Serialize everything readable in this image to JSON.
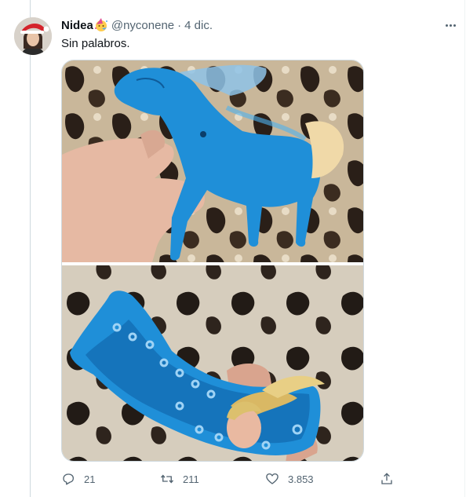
{
  "tweet": {
    "display_name": "Nidea",
    "name_emoji_icon": "party-face-icon",
    "handle": "@nyconene",
    "separator": "·",
    "date": "4 dic.",
    "text": "Sin palabros.",
    "more_icon": "more-options-icon"
  },
  "media": {
    "images": [
      {
        "subject": "blue toy horse held in hand"
      },
      {
        "subject": "hollow blue toy horse with doll head inside"
      }
    ]
  },
  "actions": {
    "reply": {
      "icon": "reply-icon",
      "count": "21"
    },
    "retweet": {
      "icon": "retweet-icon",
      "count": "211"
    },
    "like": {
      "icon": "heart-icon",
      "count": "3.853"
    },
    "share": {
      "icon": "share-icon"
    }
  },
  "colors": {
    "text_primary": "#0f1419",
    "text_secondary": "#536471",
    "border": "#cfd9de",
    "toy_blue": "#1f8fd8"
  }
}
